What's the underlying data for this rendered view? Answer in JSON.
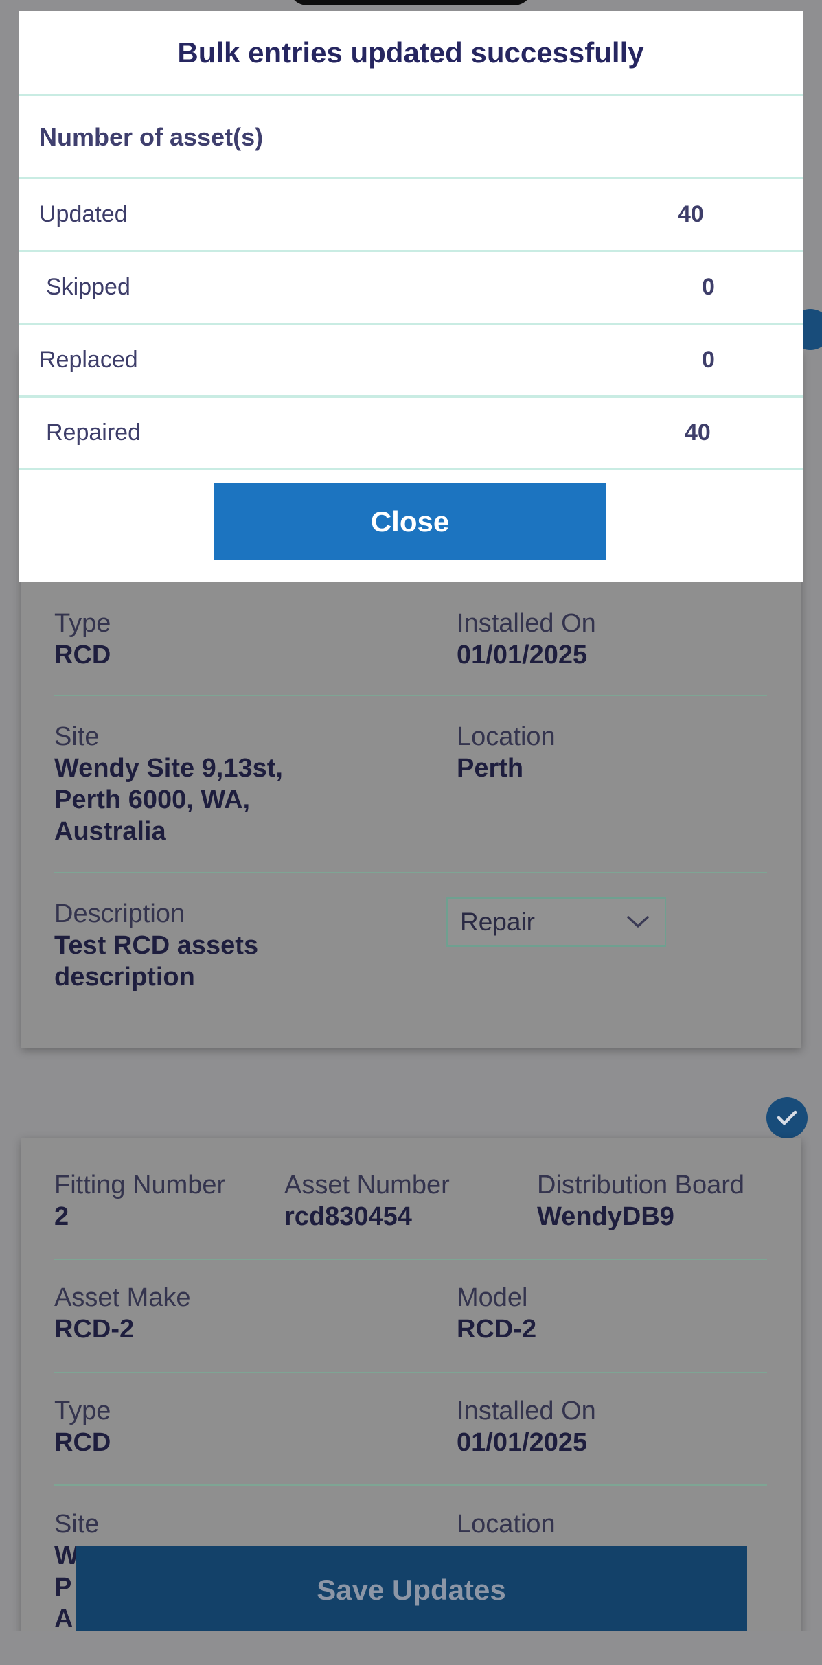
{
  "modal": {
    "title": "Bulk entries updated successfully",
    "subheading": "Number of asset(s)",
    "rows": [
      {
        "label": "Updated",
        "value": "40"
      },
      {
        "label": "Skipped",
        "value": "0"
      },
      {
        "label": "Replaced",
        "value": "0"
      },
      {
        "label": "Repaired",
        "value": "40"
      }
    ],
    "close_label": "Close"
  },
  "card1": {
    "type_label": "Type",
    "type_value": "RCD",
    "installed_label": "Installed On",
    "installed_value": "01/01/2025",
    "site_label": "Site",
    "site_value_lines": [
      "Wendy Site 9,13st,",
      "Perth 6000, WA,",
      "Australia"
    ],
    "location_label": "Location",
    "location_value": "Perth",
    "description_label": "Description",
    "description_value_lines": [
      "Test RCD assets",
      "description"
    ],
    "action_select": "Repair",
    "checked": true
  },
  "card2": {
    "fitting_label": "Fitting Number",
    "fitting_value": "2",
    "asset_number_label": "Asset Number",
    "asset_number_value": "rcd830454",
    "board_label": "Distribution Board",
    "board_value": "WendyDB9",
    "make_label": "Asset Make",
    "make_value": "RCD-2",
    "model_label": "Model",
    "model_value": "RCD-2",
    "type_label": "Type",
    "type_value": "RCD",
    "installed_label": "Installed On",
    "installed_value": "01/01/2025",
    "site_label": "Site",
    "site_value_partial": [
      "W",
      "P",
      "A"
    ],
    "location_label": "Location",
    "checked": true
  },
  "footer": {
    "save_label": "Save Updates"
  },
  "colors": {
    "primary_button": "#1C74C0",
    "save_button": "#134169",
    "check_badge": "#184C7A",
    "divider": "#C9ECE3"
  },
  "icons": [
    "checkmark-icon",
    "chevron-down-icon"
  ]
}
